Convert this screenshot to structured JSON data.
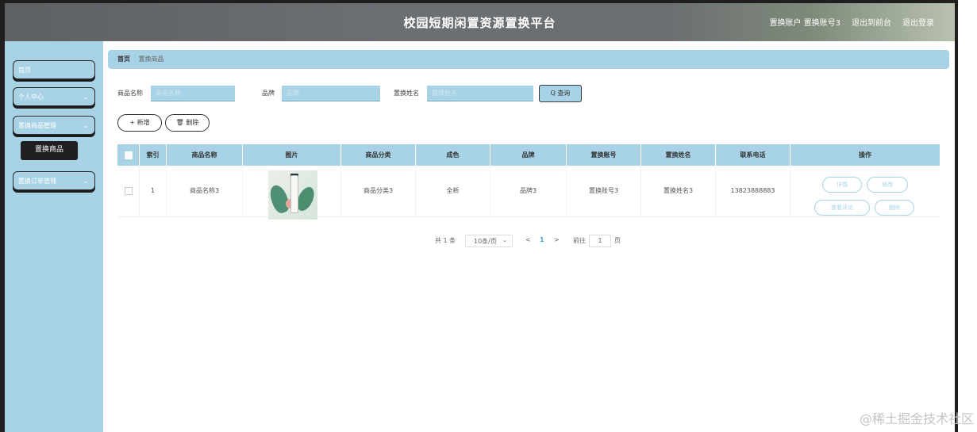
{
  "header": {
    "title": "校园短期闲置资源置换平台",
    "user_info": "置换账户 置换账号3",
    "to_front": "退出到前台",
    "logout": "退出登录"
  },
  "sidebar": {
    "items": [
      {
        "label": "首页",
        "has_chevron": false
      },
      {
        "label": "个人中心",
        "has_chevron": true
      },
      {
        "label": "置换商品管理",
        "has_chevron": true
      },
      {
        "label": "置换订单管理",
        "has_chevron": true
      }
    ],
    "submenu_active": "置换商品",
    "chevron": "⌄"
  },
  "breadcrumb": {
    "home": "首页",
    "current": "置换商品"
  },
  "search": {
    "fields": [
      {
        "label": "商品名称",
        "placeholder": "商品名称",
        "value": ""
      },
      {
        "label": "品牌",
        "placeholder": "品牌",
        "value": ""
      },
      {
        "label": "置换姓名",
        "placeholder": "置换姓名",
        "value": ""
      }
    ],
    "query_label": "Q 查询"
  },
  "actions": {
    "add_label": "+ 新增",
    "delete_label": "🗑 删除"
  },
  "table": {
    "columns": [
      "索引",
      "商品名称",
      "图片",
      "商品分类",
      "成色",
      "品牌",
      "置换账号",
      "置换姓名",
      "联系电话",
      "操作"
    ],
    "rows": [
      {
        "index": "1",
        "name": "商品名称3",
        "category": "商品分类3",
        "condition": "全新",
        "brand": "品牌3",
        "account": "置换账号3",
        "person": "置换姓名3",
        "phone": "13823888883",
        "ops": [
          "详情",
          "修改",
          "查看评论",
          "删除"
        ]
      }
    ]
  },
  "pagination": {
    "total": "共 1 条",
    "page_size": "10条/页",
    "prev": "<",
    "page": "1",
    "next": ">",
    "goto": "前往",
    "goto_value": "1",
    "page_unit": "页"
  },
  "watermark": "@稀土掘金技术社区"
}
